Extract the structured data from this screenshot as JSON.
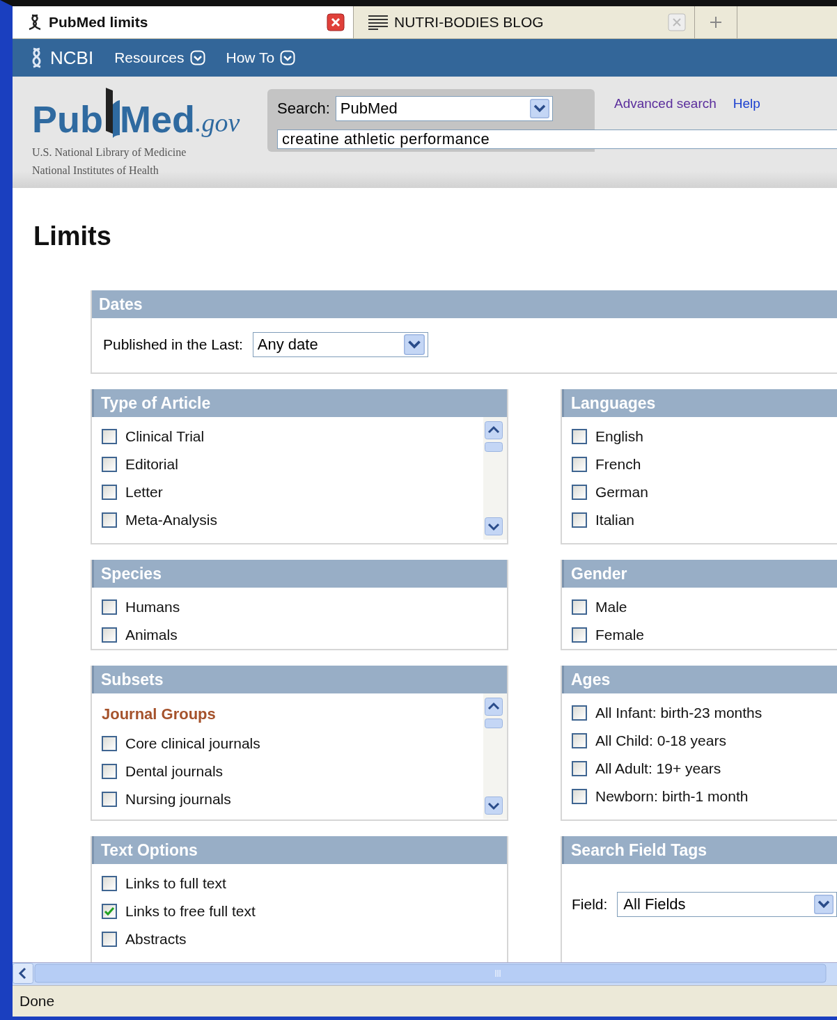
{
  "browser_tabs": [
    {
      "title": "PubMed limits",
      "selected": true
    },
    {
      "title": "NUTRI-BODIES BLOG",
      "selected": false
    }
  ],
  "ncbi_bar": {
    "logo": "NCBI",
    "menus": [
      "Resources",
      "How To"
    ]
  },
  "header": {
    "logo_parts": [
      "Pub",
      "Med",
      ".gov"
    ],
    "tagline": [
      "U.S. National Library of Medicine",
      "National Institutes of Health"
    ]
  },
  "search": {
    "label": "Search:",
    "database": "PubMed",
    "query": "creatine athletic performance",
    "links": [
      "Advanced search",
      "Help"
    ]
  },
  "page_title": "Limits",
  "dates": {
    "title": "Dates",
    "label": "Published in the Last:",
    "value": "Any date"
  },
  "panels": [
    {
      "title": "Type of Article",
      "kind": "scroll_list",
      "items": [
        {
          "kind": "checkbox",
          "label": "Clinical Trial",
          "checked": false
        },
        {
          "kind": "checkbox",
          "label": "Editorial",
          "checked": false
        },
        {
          "kind": "checkbox",
          "label": "Letter",
          "checked": false
        },
        {
          "kind": "checkbox",
          "label": "Meta-Analysis",
          "checked": false
        }
      ]
    },
    {
      "title": "Languages",
      "kind": "list",
      "items": [
        {
          "kind": "checkbox",
          "label": "English",
          "checked": false
        },
        {
          "kind": "checkbox",
          "label": "French",
          "checked": false
        },
        {
          "kind": "checkbox",
          "label": "German",
          "checked": false
        },
        {
          "kind": "checkbox",
          "label": "Italian",
          "checked": false
        }
      ]
    },
    {
      "title": "Species",
      "kind": "list",
      "items": [
        {
          "kind": "checkbox",
          "label": "Humans",
          "checked": false
        },
        {
          "kind": "checkbox",
          "label": "Animals",
          "checked": false
        }
      ]
    },
    {
      "title": "Gender",
      "kind": "list",
      "items": [
        {
          "kind": "checkbox",
          "label": "Male",
          "checked": false
        },
        {
          "kind": "checkbox",
          "label": "Female",
          "checked": false
        }
      ]
    },
    {
      "title": "Subsets",
      "kind": "scroll_list",
      "items": [
        {
          "kind": "group",
          "label": "Journal Groups"
        },
        {
          "kind": "checkbox",
          "label": "Core clinical journals",
          "checked": false
        },
        {
          "kind": "checkbox",
          "label": "Dental journals",
          "checked": false
        },
        {
          "kind": "checkbox",
          "label": "Nursing journals",
          "checked": false
        }
      ]
    },
    {
      "title": "Ages",
      "kind": "list",
      "items": [
        {
          "kind": "checkbox",
          "label": "All Infant: birth-23 months",
          "checked": false
        },
        {
          "kind": "checkbox",
          "label": "All Child: 0-18 years",
          "checked": false
        },
        {
          "kind": "checkbox",
          "label": "All Adult: 19+ years",
          "checked": false
        },
        {
          "kind": "checkbox",
          "label": "Newborn: birth-1 month",
          "checked": false
        }
      ]
    },
    {
      "title": "Text Options",
      "kind": "list",
      "items": [
        {
          "kind": "checkbox",
          "label": "Links to full text",
          "checked": false
        },
        {
          "kind": "checkbox",
          "label": "Links to free full text",
          "checked": true
        },
        {
          "kind": "checkbox",
          "label": "Abstracts",
          "checked": false
        }
      ]
    },
    {
      "title": "Search Field Tags",
      "kind": "select",
      "label": "Field:",
      "value": "All Fields"
    }
  ],
  "status_bar": {
    "text": "Done"
  }
}
